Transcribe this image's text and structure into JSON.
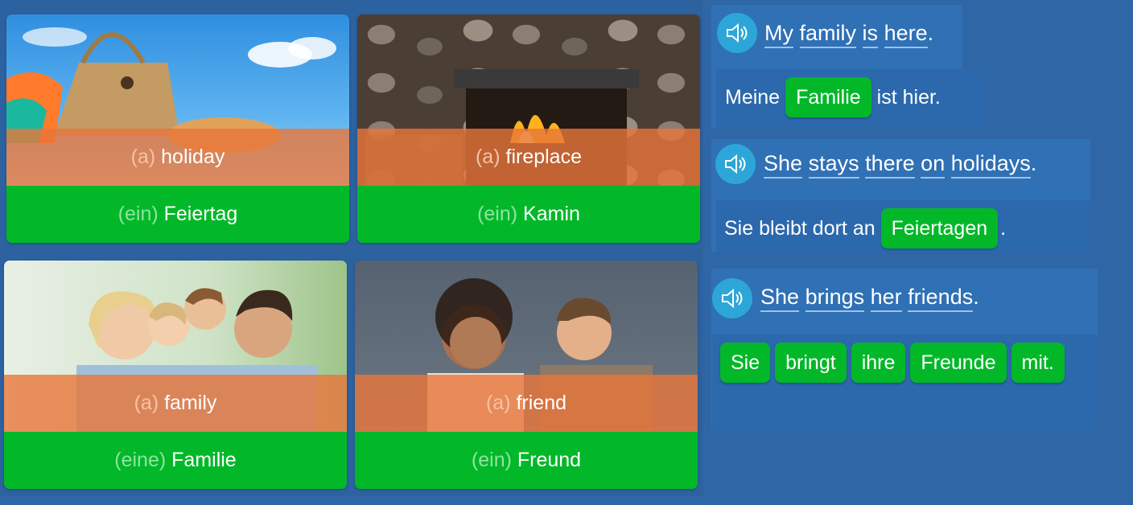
{
  "cards": [
    {
      "en_article": "(a)",
      "en_word": "holiday",
      "de_article": "(ein)",
      "de_word": "Feiertag"
    },
    {
      "en_article": "(a)",
      "en_word": "fireplace",
      "de_article": "(ein)",
      "de_word": "Kamin"
    },
    {
      "en_article": "(a)",
      "en_word": "family",
      "de_article": "(eine)",
      "de_word": "Familie"
    },
    {
      "en_article": "(a)",
      "en_word": "friend",
      "de_article": "(ein)",
      "de_word": "Freund"
    }
  ],
  "exercises": [
    {
      "sentence_words": [
        "My",
        "family",
        "is",
        "here",
        "."
      ],
      "answer_before": "Meine",
      "answer_chip": "Familie",
      "answer_after": "ist hier."
    },
    {
      "sentence_words": [
        "She",
        "stays",
        "there",
        "on",
        "holidays",
        "."
      ],
      "answer_before": "Sie bleibt dort an",
      "answer_chip": "Feiertagen",
      "answer_after": "."
    },
    {
      "sentence_words": [
        "She",
        "brings",
        "her",
        "friends",
        "."
      ],
      "word_choices": [
        "Sie",
        "bringt",
        "ihre",
        "Freunde",
        "mit."
      ]
    }
  ],
  "icons": {
    "audio": "speaker-icon"
  },
  "colors": {
    "green": "#02b829",
    "orange": "#e8763a",
    "blue_bg": "#2f66a6",
    "speaker": "#2ca6d8"
  }
}
